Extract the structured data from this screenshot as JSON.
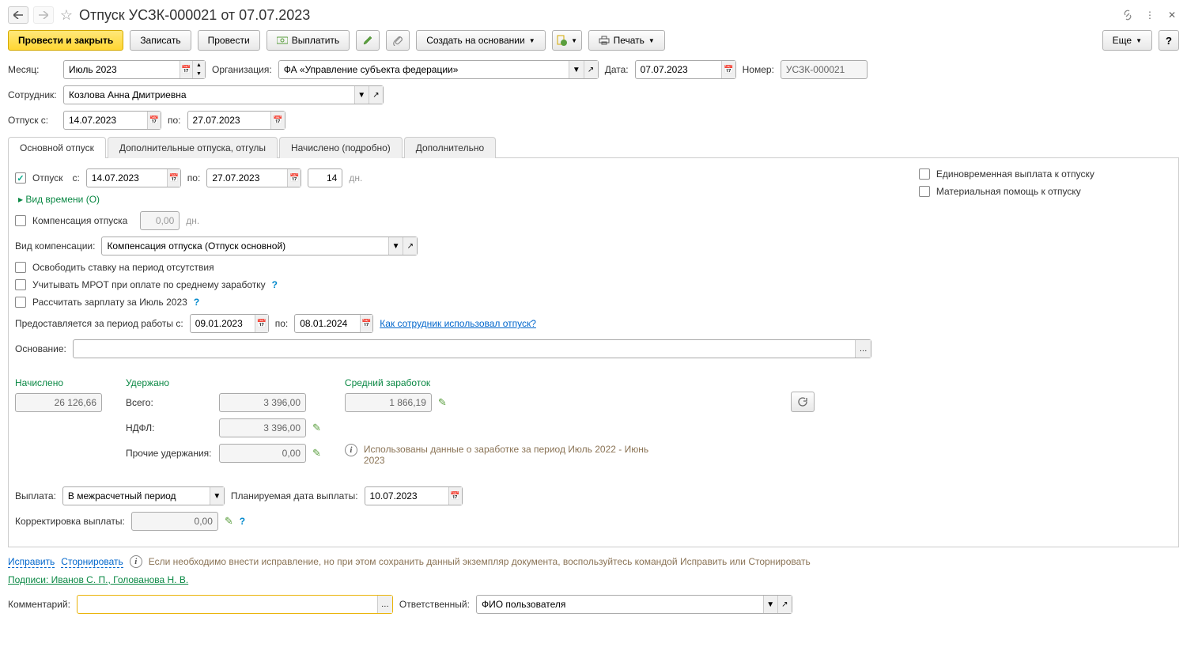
{
  "title": "Отпуск УСЗК-000021 от 07.07.2023",
  "toolbar": {
    "post_close": "Провести и закрыть",
    "save": "Записать",
    "post": "Провести",
    "pay": "Выплатить",
    "create_based": "Создать на основании",
    "print": "Печать",
    "more": "Еще"
  },
  "header": {
    "month_label": "Месяц:",
    "month": "Июль 2023",
    "org_label": "Организация:",
    "org": "ФА «Управление субъекта федерации»",
    "date_label": "Дата:",
    "date": "07.07.2023",
    "number_label": "Номер:",
    "number": "УСЗК-000021",
    "employee_label": "Сотрудник:",
    "employee": "Козлова Анна Дмитриевна",
    "vac_from_label": "Отпуск с:",
    "vac_from": "14.07.2023",
    "to_label": "по:",
    "vac_to": "27.07.2023"
  },
  "tabs": [
    "Основной отпуск",
    "Дополнительные отпуска, отгулы",
    "Начислено (подробно)",
    "Дополнительно"
  ],
  "main": {
    "vacation_chk": "Отпуск",
    "from_label": "с:",
    "from": "14.07.2023",
    "to_label": "по:",
    "to": "27.07.2023",
    "days": "14",
    "days_suffix": "дн.",
    "time_type": "Вид времени (О)",
    "bonus_chk": "Единовременная выплата к отпуску",
    "mat_help_chk": "Материальная помощь к отпуску",
    "comp_chk": "Компенсация отпуска",
    "comp_days": "0,00",
    "comp_suffix": "дн.",
    "comp_type_label": "Вид компенсации:",
    "comp_type": "Компенсация отпуска (Отпуск основной)",
    "release_chk": "Освободить ставку на период отсутствия",
    "mrot_chk": "Учитывать МРОТ при оплате по среднему заработку",
    "recalc_chk": "Рассчитать зарплату за Июль 2023",
    "period_label": "Предоставляется за период работы с:",
    "period_from": "09.01.2023",
    "period_to_label": "по:",
    "period_to": "08.01.2024",
    "usage_link": "Как сотрудник использовал отпуск?",
    "basis_label": "Основание:",
    "basis": ""
  },
  "totals": {
    "accrued_label": "Начислено",
    "accrued": "26 126,66",
    "withheld_label": "Удержано",
    "all_label": "Всего:",
    "withheld_all": "3 396,00",
    "ndfl_label": "НДФЛ:",
    "ndfl": "3 396,00",
    "other_label": "Прочие удержания:",
    "other": "0,00",
    "avg_label": "Средний заработок",
    "avg": "1 866,19",
    "data_note": "Использованы данные о заработке за период Июль 2022 - Июнь 2023"
  },
  "payment": {
    "label": "Выплата:",
    "value": "В межрасчетный период",
    "plan_label": "Планируемая дата выплаты:",
    "plan_date": "10.07.2023",
    "corr_label": "Корректировка выплаты:",
    "corr": "0,00"
  },
  "footer": {
    "fix": "Исправить",
    "reverse": "Сторнировать",
    "note": "Если необходимо внести исправление, но при этом сохранить данный экземпляр документа, воспользуйтесь командой Исправить или Сторнировать",
    "signatures": "Подписи: Иванов С. П., Голованова Н. В.",
    "comment_label": "Комментарий:",
    "comment": "",
    "resp_label": "Ответственный:",
    "resp": "ФИО пользователя"
  }
}
